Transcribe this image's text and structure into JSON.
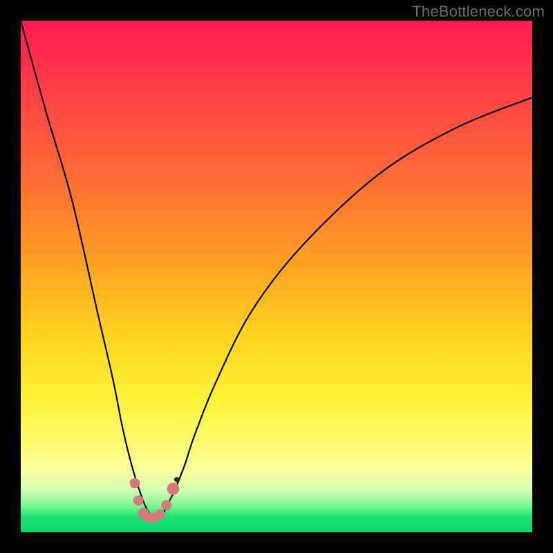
{
  "watermark": "TheBottleneck.com",
  "chart_data": {
    "type": "line",
    "title": "",
    "xlabel": "",
    "ylabel": "",
    "xlim": [
      0,
      100
    ],
    "ylim": [
      0,
      100
    ],
    "series": [
      {
        "name": "curve",
        "x": [
          0,
          5,
          10,
          15,
          18,
          20,
          22,
          24,
          25,
          26,
          27,
          28,
          29,
          30,
          32,
          34,
          38,
          45,
          55,
          70,
          85,
          100
        ],
        "y": [
          100,
          82,
          65,
          43,
          30,
          20,
          12,
          6,
          4,
          3,
          3,
          4,
          6,
          8,
          13,
          19,
          29,
          43,
          56,
          70,
          79,
          85
        ]
      }
    ],
    "markers": [
      {
        "x": 22.3,
        "y": 9.6,
        "r": 1.0,
        "kind": "pink"
      },
      {
        "x": 23.0,
        "y": 6.2,
        "r": 1.0,
        "kind": "pink"
      },
      {
        "x": 24.0,
        "y": 3.7,
        "r": 1.1,
        "kind": "pink"
      },
      {
        "x": 25.0,
        "y": 2.9,
        "r": 1.0,
        "kind": "pink"
      },
      {
        "x": 26.0,
        "y": 2.8,
        "r": 1.0,
        "kind": "pink"
      },
      {
        "x": 27.2,
        "y": 3.5,
        "r": 1.0,
        "kind": "pink"
      },
      {
        "x": 28.5,
        "y": 5.3,
        "r": 1.0,
        "kind": "pink"
      },
      {
        "x": 29.8,
        "y": 8.5,
        "r": 1.2,
        "kind": "pink"
      },
      {
        "x": 30.5,
        "y": 10.3,
        "r": 0.5,
        "kind": "dark"
      }
    ]
  }
}
